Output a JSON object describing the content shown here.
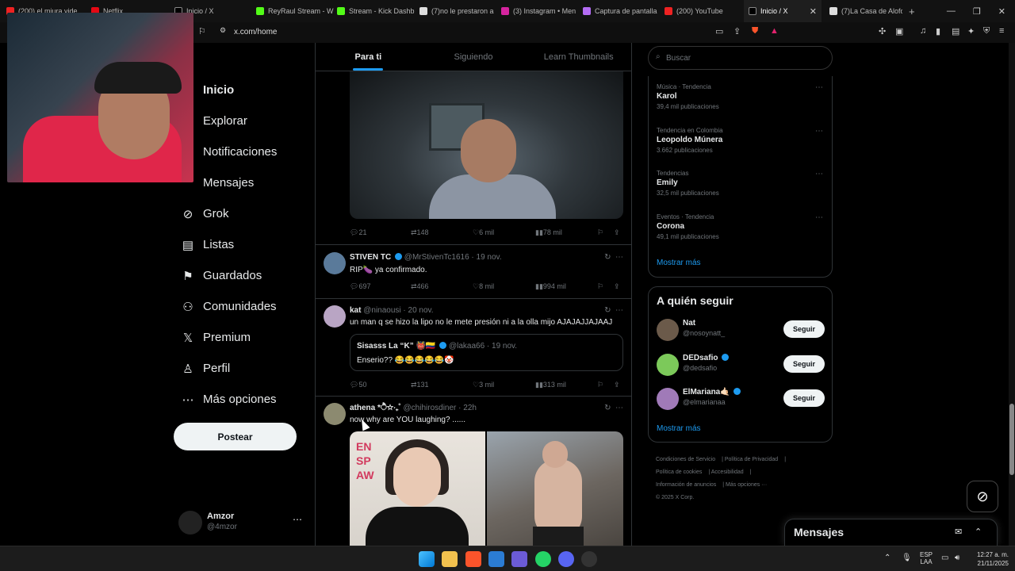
{
  "browser": {
    "tabs": [
      {
        "label": "(200) el miura vide",
        "color": "#e22"
      },
      {
        "label": "Netflix",
        "color": "#e50914"
      },
      {
        "label": "Inicio / X",
        "color": "#fff"
      },
      {
        "label": "ReyRaul Stream - W",
        "color": "#53fc18"
      },
      {
        "label": "Stream - Kick Dashb",
        "color": "#53fc18"
      },
      {
        "label": "(7)no le prestaron a",
        "color": "#fff"
      },
      {
        "label": "(3) Instagram • Men",
        "color": "#d6249f"
      },
      {
        "label": "Captura de pantalla",
        "color": "#b36cf3"
      },
      {
        "label": "(200) YouTube",
        "color": "#e22"
      },
      {
        "label": "Inicio / X",
        "color": "#fff"
      },
      {
        "label": "(7)La Casa de Alofo",
        "color": "#fff"
      }
    ],
    "new_tab": "+",
    "url": "x.com/home"
  },
  "nav": {
    "items": [
      {
        "label": "Inicio",
        "icon": "home-icon",
        "glyph": ""
      },
      {
        "label": "Explorar",
        "icon": "search-icon",
        "glyph": ""
      },
      {
        "label": "Notificaciones",
        "icon": "bell-icon",
        "glyph": ""
      },
      {
        "label": "Mensajes",
        "icon": "mail-icon",
        "glyph": ""
      },
      {
        "label": "Grok",
        "icon": "grok-icon",
        "glyph": "⊘"
      },
      {
        "label": "Listas",
        "icon": "list-icon",
        "glyph": "▤"
      },
      {
        "label": "Guardados",
        "icon": "bookmark-icon",
        "glyph": "⚑"
      },
      {
        "label": "Comunidades",
        "icon": "people-icon",
        "glyph": "⚇"
      },
      {
        "label": "Premium",
        "icon": "x-logo-icon",
        "glyph": "𝕏"
      },
      {
        "label": "Perfil",
        "icon": "person-icon",
        "glyph": "♙"
      },
      {
        "label": "Más opciones",
        "icon": "more-circle-icon",
        "glyph": "⋯"
      }
    ],
    "post_button": "Postear",
    "account": {
      "name": "Amzor",
      "handle": "@4mzor"
    }
  },
  "feed": {
    "tabs": [
      "Para ti",
      "Siguiendo",
      "Learn Thumbnails"
    ],
    "first_post_actions": {
      "replies": "21",
      "reposts": "148",
      "likes": "6 mil",
      "views": "78 mil"
    },
    "tweets": [
      {
        "name": "STIVEN TC",
        "handle": "@MrStivenTc1616 · 19 nov.",
        "text": "RIP🍆 ya confirmado.",
        "replies": "697",
        "reposts": "466",
        "likes": "8 mil",
        "views": "994 mil"
      },
      {
        "name": "kat",
        "handle": "@ninaousi · 20 nov.",
        "text": "un man q se hizo la lipo no le mete presión ni a la olla mijo AJAJAJJAJAAJ",
        "quote": {
          "name": "Sisasss La “K” 👹🇨🇴",
          "handle": "@lakaa66 · 19 nov.",
          "text": "Enserio?? 😂😂😂😂😂🤡"
        },
        "replies": "50",
        "reposts": "131",
        "likes": "3 mil",
        "views": "313 mil"
      },
      {
        "name": "athena *ੈ✩‧₊˚",
        "handle": "@chihirosdiner · 22h",
        "text": "now why are YOU laughing? ......"
      }
    ],
    "image_sign": [
      "EN",
      "SP",
      "AW"
    ]
  },
  "sidebar": {
    "search_placeholder": "Buscar",
    "trends": [
      {
        "context": "Música · Tendencia",
        "name": "Karol",
        "count": "39,4 mil publicaciones"
      },
      {
        "context": "Tendencia en Colombia",
        "name": "Leopoldo Múnera",
        "count": "3.662 publicaciones"
      },
      {
        "context": "Tendencias",
        "name": "Emily",
        "count": "32,5 mil publicaciones"
      },
      {
        "context": "Eventos · Tendencia",
        "name": "Corona",
        "count": "49,1 mil publicaciones"
      }
    ],
    "show_more": "Mostrar más",
    "who_to_follow": {
      "title": "A quién seguir",
      "users": [
        {
          "name": "Nat",
          "handle": "@nosoynatt_",
          "button": "Seguir",
          "verified": false
        },
        {
          "name": "DEDsafio",
          "handle": "@dedsafio",
          "button": "Seguir",
          "verified": true
        },
        {
          "name": "ElMariana🤙🏻",
          "handle": "@elmarianaa",
          "button": "Seguir",
          "verified": true
        }
      ],
      "show_more": "Mostrar más"
    },
    "footer": [
      "Condiciones de Servicio",
      "Política de Privacidad",
      "Política de cookies",
      "Accesibilidad",
      "Información de anuncios",
      "Más opciones ···",
      "© 2025 X Corp."
    ]
  },
  "messages": {
    "title": "Mensajes"
  },
  "taskbar": {
    "lang": "ESP",
    "region": "LAA",
    "time": "12:27 a. m.",
    "date": "21/11/2025"
  },
  "colors": {
    "accent": "#1d9bf0",
    "background": "#000000",
    "border": "#2f3336"
  }
}
